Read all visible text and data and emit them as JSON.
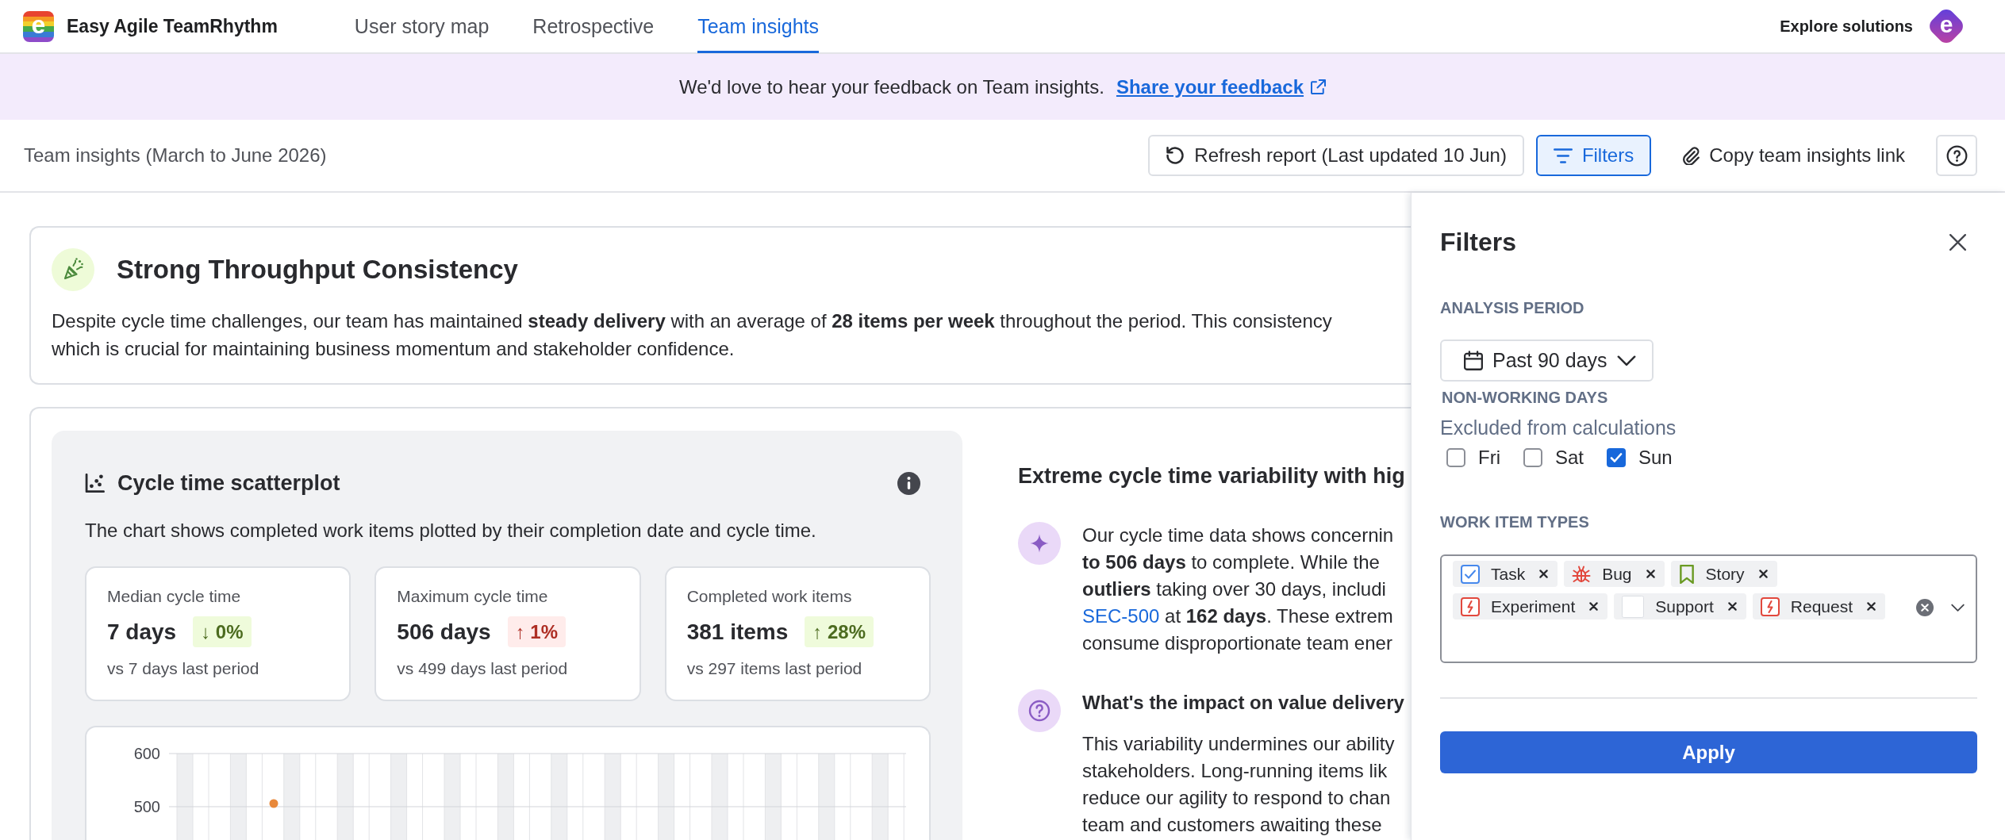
{
  "nav": {
    "logo_letter": "e",
    "product_name": "Easy Agile TeamRhythm",
    "tabs": [
      {
        "label": "User story map",
        "selected": false
      },
      {
        "label": "Retrospective",
        "selected": false
      },
      {
        "label": "Team insights",
        "selected": true
      }
    ],
    "explore_link": "Explore solutions",
    "avatar_letter": "e"
  },
  "banner": {
    "message": "We'd love to hear your feedback on Team insights.",
    "link": "Share your feedback"
  },
  "toolbar": {
    "title": "Team insights (March to June 2026)",
    "buttons": [
      {
        "kind": "outline",
        "label": "Refresh report (Last updated 10 Jun)",
        "selected": false
      },
      {
        "kind": "outline",
        "label": "Filters",
        "selected": true
      },
      {
        "kind": "subtle",
        "label": "Copy team insights link",
        "selected": false
      },
      {
        "kind": "icon",
        "selected": false
      }
    ]
  },
  "highlight": {
    "title": "Strong Throughput Consistency",
    "lines": [
      "Despite cycle time challenges, our team has maintained **steady delivery** with an average of **28 items per week** throughout the period. This consistency",
      "which is crucial for maintaining business momentum and stakeholder confidence."
    ]
  },
  "scatterplot": {
    "title": "Cycle time scatterplot",
    "description": "The chart shows completed work items plotted by their completion date and cycle time.",
    "stats": [
      {
        "label": "Median cycle time",
        "value": "7 days",
        "change": "↓ 0%",
        "kind": "positive",
        "comparison": "vs 7 days last period"
      },
      {
        "label": "Maximum cycle time",
        "value": "506 days",
        "change": "↑ 1%",
        "kind": "negative",
        "comparison": "vs 499 days last period"
      },
      {
        "label": "Completed work items",
        "value": "381 items",
        "change": "↑ 28%",
        "kind": "positive",
        "comparison": "vs 297 items last period"
      }
    ],
    "y_axis_labels": [
      "600",
      "500"
    ]
  },
  "analysis": {
    "title": "Extreme cycle time variability with hig",
    "insights": [
      {
        "kind": "finding",
        "lines": [
          [
            {
              "kind": "text",
              "text": "Our cycle time data shows concernin"
            }
          ],
          [
            {
              "kind": "text",
              "text": "**to 506 days** to complete. While the"
            }
          ],
          [
            {
              "kind": "text",
              "text": "**outliers** taking over 30 days, includi"
            }
          ],
          [
            {
              "kind": "link",
              "text": "SEC-500"
            },
            {
              "kind": "text",
              "text": " at **162 days**. These extrem"
            }
          ],
          [
            {
              "kind": "text",
              "text": "consume disproportionate team ener"
            }
          ]
        ]
      },
      {
        "kind": "impact",
        "heading": "What's the impact on value delivery",
        "lines": [
          [
            {
              "kind": "text",
              "text": "This variability undermines our ability"
            }
          ],
          [
            {
              "kind": "text",
              "text": "stakeholders. Long-running items lik"
            }
          ],
          [
            {
              "kind": "text",
              "text": "reduce our agility to respond to chan"
            }
          ],
          [
            {
              "kind": "text",
              "text": "team and customers awaiting these"
            }
          ]
        ]
      }
    ]
  },
  "filters": {
    "title": "Filters",
    "analysis_period": {
      "label": "ANALYSIS PERIOD",
      "value": "Past 90 days"
    },
    "non_working_days": {
      "label": "NON-WORKING DAYS",
      "hint": "Excluded from calculations",
      "days": [
        {
          "label": "Fri",
          "checked": false
        },
        {
          "label": "Sat",
          "checked": false
        },
        {
          "label": "Sun",
          "checked": true
        }
      ]
    },
    "work_item_types": {
      "label": "WORK ITEM TYPES",
      "tags": [
        {
          "label": "Task",
          "kind": "task"
        },
        {
          "label": "Bug",
          "kind": "bug"
        },
        {
          "label": "Story",
          "kind": "story"
        },
        {
          "label": "Experiment",
          "kind": "experiment"
        },
        {
          "label": "Support",
          "kind": "support"
        },
        {
          "label": "Request",
          "kind": "request"
        }
      ]
    },
    "apply_button": "Apply"
  }
}
